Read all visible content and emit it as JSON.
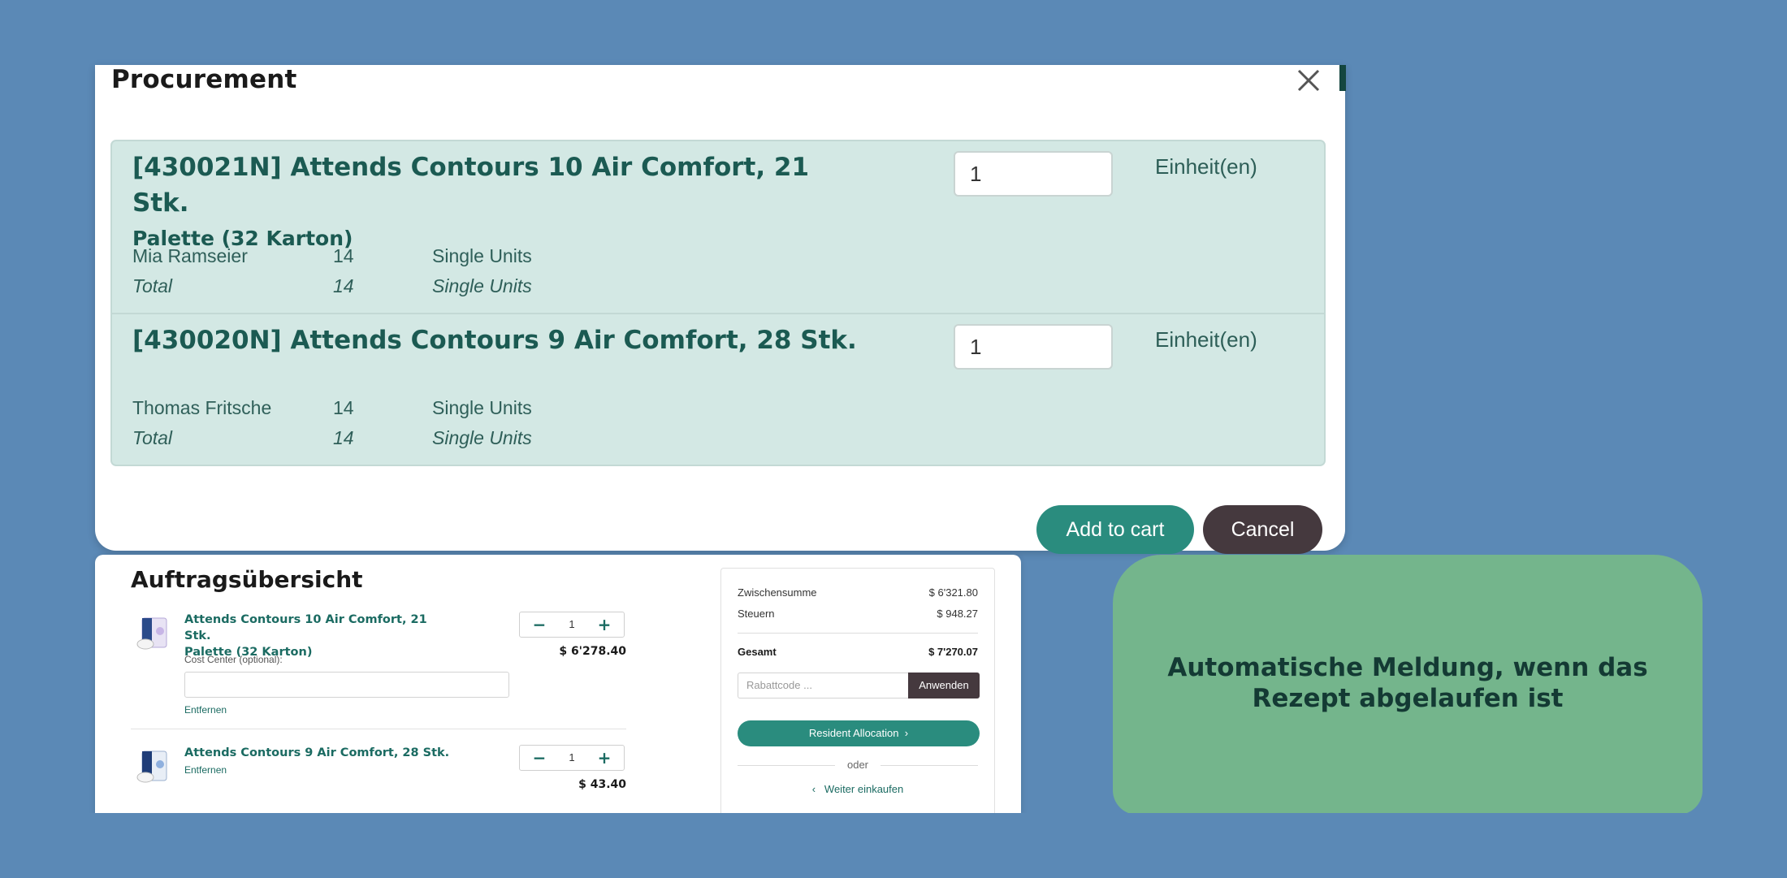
{
  "procurement": {
    "title": "Procurement",
    "items": [
      {
        "name": "[430021N] Attends Contours 10 Air Comfort, 21 Stk.",
        "name_sub": "Palette (32 Karton)",
        "quantity": "1",
        "unit": "Einheit(en)",
        "allocations": [
          {
            "name": "Mia Ramseier",
            "qty": "14",
            "unit": "Single Units"
          },
          {
            "name": "Total",
            "qty": "14",
            "unit": "Single Units"
          }
        ]
      },
      {
        "name": "[430020N] Attends Contours 9 Air Comfort, 28 Stk.",
        "name_sub": "",
        "quantity": "1",
        "unit": "Einheit(en)",
        "allocations": [
          {
            "name": "Thomas Fritsche",
            "qty": "14",
            "unit": "Single Units"
          },
          {
            "name": "Total",
            "qty": "14",
            "unit": "Single Units"
          }
        ]
      }
    ],
    "add_to_cart_label": "Add to cart",
    "cancel_label": "Cancel"
  },
  "order": {
    "title": "Auftragsübersicht",
    "items": [
      {
        "name": "Attends Contours 10 Air Comfort, 21 Stk.",
        "name_line2": "Palette (32 Karton)",
        "quantity": "1",
        "price": "$ 6'278.40",
        "cost_center_label": "Cost Center (optional):",
        "remove_label": "Entfernen"
      },
      {
        "name": "Attends Contours 9 Air Comfort, 28 Stk.",
        "quantity": "1",
        "price": "$ 43.40",
        "remove_label": "Entfernen"
      }
    ],
    "summary": {
      "subtotal_label": "Zwischensumme",
      "subtotal": "$ 6'321.80",
      "tax_label": "Steuern",
      "tax": "$ 948.27",
      "total_label": "Gesamt",
      "total": "$ 7'270.07",
      "coupon_placeholder": "Rabattcode ...",
      "apply_label": "Anwenden",
      "allocation_label": "Resident Allocation",
      "or_label": "oder",
      "continue_label": "Weiter einkaufen"
    }
  },
  "notice": {
    "line1": "Automatische Meldung, wenn das",
    "line2": "Rezept abgelaufen ist"
  },
  "colors": {
    "background": "#5b89b6",
    "accent": "#2a8c7e",
    "dark_button": "#45393e",
    "notice_bg": "#74b58c"
  },
  "icons": {
    "close": "close-icon",
    "minus": "minus-icon",
    "plus": "plus-icon",
    "chevron_right": "chevron-right-icon",
    "chevron_left": "chevron-left-icon"
  }
}
